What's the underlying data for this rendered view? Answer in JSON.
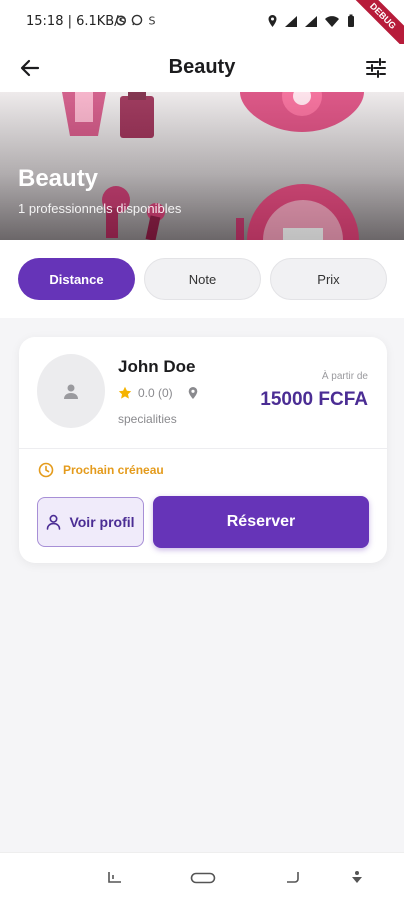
{
  "status_bar": {
    "time_speed": "15:18 | 6.1KB/s",
    "debug_label": "DEBUG"
  },
  "app_bar": {
    "title": "Beauty",
    "back_icon": "arrow-left-icon",
    "filter_icon": "sliders-icon"
  },
  "hero": {
    "title": "Beauty",
    "subtitle": "1 professionnels disponibles"
  },
  "sort_chips": [
    {
      "label": "Distance",
      "active": true
    },
    {
      "label": "Note",
      "active": false
    },
    {
      "label": "Prix",
      "active": false
    }
  ],
  "professional": {
    "name": "John Doe",
    "rating": "0.0 (0)",
    "specialities": "specialities",
    "price_label": "À partir de",
    "price": "15000 FCFA",
    "slot": "Prochain créneau",
    "profile_button": "Voir profil",
    "book_button": "Réserver"
  },
  "colors": {
    "primary": "#6634b8",
    "price": "#4b2d94",
    "slot": "#e49b1c",
    "star": "#f5b301"
  }
}
